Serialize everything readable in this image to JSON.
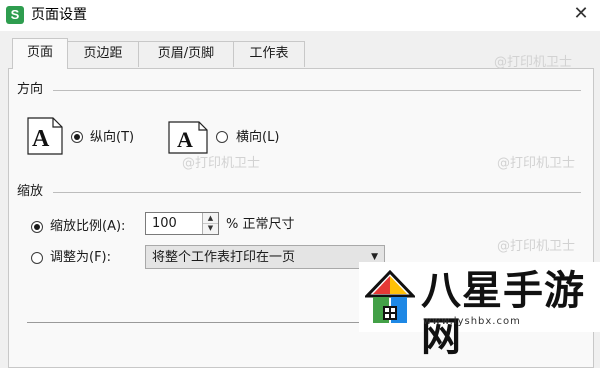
{
  "window": {
    "app_icon_letter": "S",
    "title": "页面设置",
    "close_symbol": "✕"
  },
  "tabs": [
    {
      "label": "页面",
      "active": true
    },
    {
      "label": "页边距",
      "active": false
    },
    {
      "label": "页眉/页脚",
      "active": false
    },
    {
      "label": "工作表",
      "active": false
    }
  ],
  "orientation": {
    "section_label": "方向",
    "portrait_label": "纵向(T)",
    "landscape_label": "横向(L)",
    "selected": "portrait",
    "icon_letter": "A"
  },
  "scaling": {
    "section_label": "缩放",
    "scale_label": "缩放比例(A):",
    "scale_value": "100",
    "scale_suffix": "% 正常尺寸",
    "fit_label": "调整为(F):",
    "fit_option": "将整个工作表打印在一页",
    "selected": "scale"
  },
  "watermark": {
    "text": "@打印机卫士",
    "site_name": "八星手游网",
    "site_url": "www.lyshbx.com",
    "colors": [
      "#e53935",
      "#ffc107",
      "#43a047",
      "#1e88e5"
    ]
  }
}
